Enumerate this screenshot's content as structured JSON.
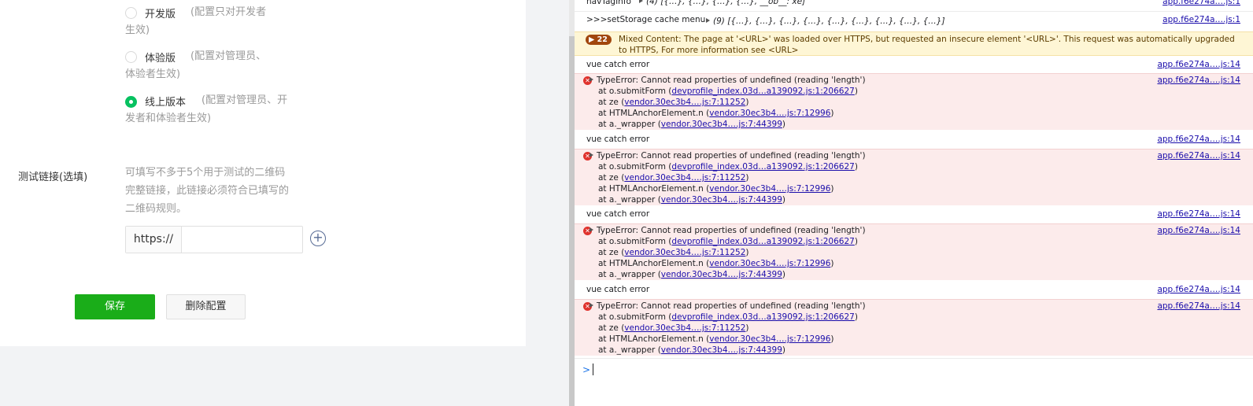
{
  "form": {
    "options": [
      {
        "label": "开发版",
        "desc_line1": "(配置只对开发者",
        "desc_line2": "生效)",
        "checked": false
      },
      {
        "label": "体验版",
        "desc_line1": "(配置对管理员、",
        "desc_line2": "体验者生效)",
        "checked": false
      },
      {
        "label": "线上版本",
        "desc_line1": "(配置对管理员、开",
        "desc_line2": "发者和体验者生效)",
        "checked": true
      }
    ],
    "test_link_label": "测试链接(选填)",
    "test_link_desc": [
      "可填写不多于5个用于测试的二维码",
      "完整链接，此链接必须符合已填写的",
      "二维码规则。"
    ],
    "url_prefix": "https://",
    "url_value": "",
    "add_symbol": "+",
    "save_label": "保存",
    "delete_label": "删除配置"
  },
  "console": {
    "top_rows": [
      {
        "label": "navTagInfo",
        "value": "(4) [{…}, {…}, {…}, {…}, __ob__: xe]",
        "source": "app.f6e274a….js:1"
      },
      {
        "label": ">>>setStorage cache menu",
        "value": "(9) [{…}, {…}, {…}, {…}, {…}, {…}, {…}, {…}, {…}]",
        "source": "app.f6e274a….js:1"
      }
    ],
    "warning": {
      "count": "22",
      "text": "Mixed Content: The page at '<URL>' was loaded over HTTPS, but requested an insecure element '<URL>'. This request was automatically upgraded to HTTPS, For more information see <URL>"
    },
    "groups": [
      {
        "log": "vue catch error",
        "log_source": "app.f6e274a….js:14",
        "error": "TypeError: Cannot read properties of undefined (reading 'length')",
        "error_source": "app.f6e274a….js:14",
        "frames": [
          {
            "fn": "at o.submitForm (",
            "link": "devprofile_index.03d…a139092.js:1:206627",
            "end": ")"
          },
          {
            "fn": "at ze (",
            "link": "vendor.30ec3b4….js:7:11252",
            "end": ")"
          },
          {
            "fn": "at HTMLAnchorElement.n (",
            "link": "vendor.30ec3b4….js:7:12996",
            "end": ")"
          },
          {
            "fn": "at a._wrapper (",
            "link": "vendor.30ec3b4….js:7:44399",
            "end": ")"
          }
        ]
      },
      {
        "log": "vue catch error",
        "log_source": "app.f6e274a….js:14",
        "error": "TypeError: Cannot read properties of undefined (reading 'length')",
        "error_source": "app.f6e274a….js:14",
        "frames": [
          {
            "fn": "at o.submitForm (",
            "link": "devprofile_index.03d…a139092.js:1:206627",
            "end": ")"
          },
          {
            "fn": "at ze (",
            "link": "vendor.30ec3b4….js:7:11252",
            "end": ")"
          },
          {
            "fn": "at HTMLAnchorElement.n (",
            "link": "vendor.30ec3b4….js:7:12996",
            "end": ")"
          },
          {
            "fn": "at a._wrapper (",
            "link": "vendor.30ec3b4….js:7:44399",
            "end": ")"
          }
        ]
      },
      {
        "log": "vue catch error",
        "log_source": "app.f6e274a….js:14",
        "error": "TypeError: Cannot read properties of undefined (reading 'length')",
        "error_source": "app.f6e274a….js:14",
        "frames": [
          {
            "fn": "at o.submitForm (",
            "link": "devprofile_index.03d…a139092.js:1:206627",
            "end": ")"
          },
          {
            "fn": "at ze (",
            "link": "vendor.30ec3b4….js:7:11252",
            "end": ")"
          },
          {
            "fn": "at HTMLAnchorElement.n (",
            "link": "vendor.30ec3b4….js:7:12996",
            "end": ")"
          },
          {
            "fn": "at a._wrapper (",
            "link": "vendor.30ec3b4….js:7:44399",
            "end": ")"
          }
        ]
      },
      {
        "log": "vue catch error",
        "log_source": "app.f6e274a….js:14",
        "error": "TypeError: Cannot read properties of undefined (reading 'length')",
        "error_source": "app.f6e274a….js:14",
        "frames": [
          {
            "fn": "at o.submitForm (",
            "link": "devprofile_index.03d…a139092.js:1:206627",
            "end": ")"
          },
          {
            "fn": "at ze (",
            "link": "vendor.30ec3b4….js:7:11252",
            "end": ")"
          },
          {
            "fn": "at HTMLAnchorElement.n (",
            "link": "vendor.30ec3b4….js:7:12996",
            "end": ")"
          },
          {
            "fn": "at a._wrapper (",
            "link": "vendor.30ec3b4….js:7:44399",
            "end": ")"
          }
        ]
      }
    ],
    "prompt_symbol": ">"
  }
}
